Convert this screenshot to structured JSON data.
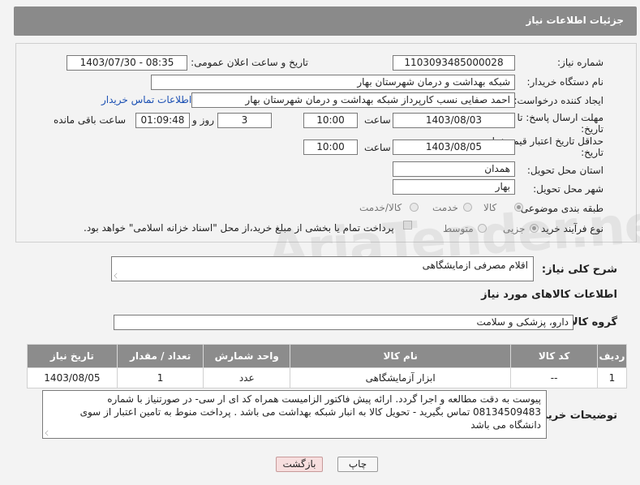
{
  "header": {
    "title": "جزئیات اطلاعات نیاز"
  },
  "form": {
    "need_number": {
      "label": "شماره نیاز:",
      "value": "1103093485000028"
    },
    "announce": {
      "label": "تاریخ و ساعت اعلان عمومی:",
      "value": "1403/07/30 - 08:35"
    },
    "buyer_org": {
      "label": "نام دستگاه خریدار:",
      "value": "شبکه بهداشت و درمان شهرستان بهار"
    },
    "creator": {
      "label": "ایجاد کننده درخواست:",
      "value": "احمد صفایی نسب کارپرداز شبکه بهداشت و درمان شهرستان بهار",
      "contact_link": "اطلاعات تماس خریدار"
    },
    "deadline": {
      "label_line1": "مهلت ارسال پاسخ: تا",
      "label_line2": "تاریخ:",
      "date": "1403/08/03",
      "time_label": "ساعت",
      "time": "10:00",
      "days_label": "روز و",
      "days": "3",
      "remaining": "01:09:48",
      "remaining_label": "ساعت باقی مانده"
    },
    "price_validity": {
      "label_line1": "حداقل تاریخ اعتبار قیمت: تا",
      "label_line2": "تاریخ:",
      "date": "1403/08/05",
      "time_label": "ساعت",
      "time": "10:00"
    },
    "province": {
      "label": "استان محل تحویل:",
      "value": "همدان"
    },
    "city": {
      "label": "شهر محل تحویل:",
      "value": "بهار"
    },
    "category": {
      "label": "طبقه بندی موضوعی:",
      "options": [
        "کالا",
        "خدمت",
        "کالا/خدمت"
      ],
      "selected": "کالا"
    },
    "purchase_type": {
      "label": "نوع فرآیند خرید :",
      "options": [
        "جزیی",
        "متوسط"
      ],
      "selected": "جزیی",
      "payment_note": "پرداخت تمام یا بخشی از مبلغ خرید،از محل \"اسناد خزانه اسلامی\" خواهد بود."
    }
  },
  "watermark": "AriaTender.neT",
  "summary": {
    "label": "شرح کلی نیاز:",
    "value": "اقلام مصرفی ازمایشگاهی"
  },
  "goods_section": {
    "title": "اطلاعات کالاهای مورد نیاز"
  },
  "goods_group": {
    "label": "گروه کالا:",
    "value": "دارو، پزشکی و سلامت"
  },
  "table": {
    "headers": [
      "ردیف",
      "کد کالا",
      "نام کالا",
      "واحد شمارش",
      "تعداد / مقدار",
      "تاریخ نیاز"
    ],
    "rows": [
      [
        "1",
        "--",
        "ابزار آزمایشگاهی",
        "عدد",
        "1",
        "1403/08/05"
      ]
    ]
  },
  "buyer_notes": {
    "label": "توضیحات خریدار:",
    "value": "پیوست به دقت مطالعه و اجرا گردد. ارائه پیش فاکتور الزامیست همراه کد ای ار سی- در صورتنیاز با شماره 08134509483 تماس بگیرید - تحویل کالا به انبار شبکه بهداشت می باشد . پرداخت منوط به تامین اعتبار از سوی دانشگاه می باشد"
  },
  "buttons": {
    "print": "چاپ",
    "back": "بازگشت"
  }
}
